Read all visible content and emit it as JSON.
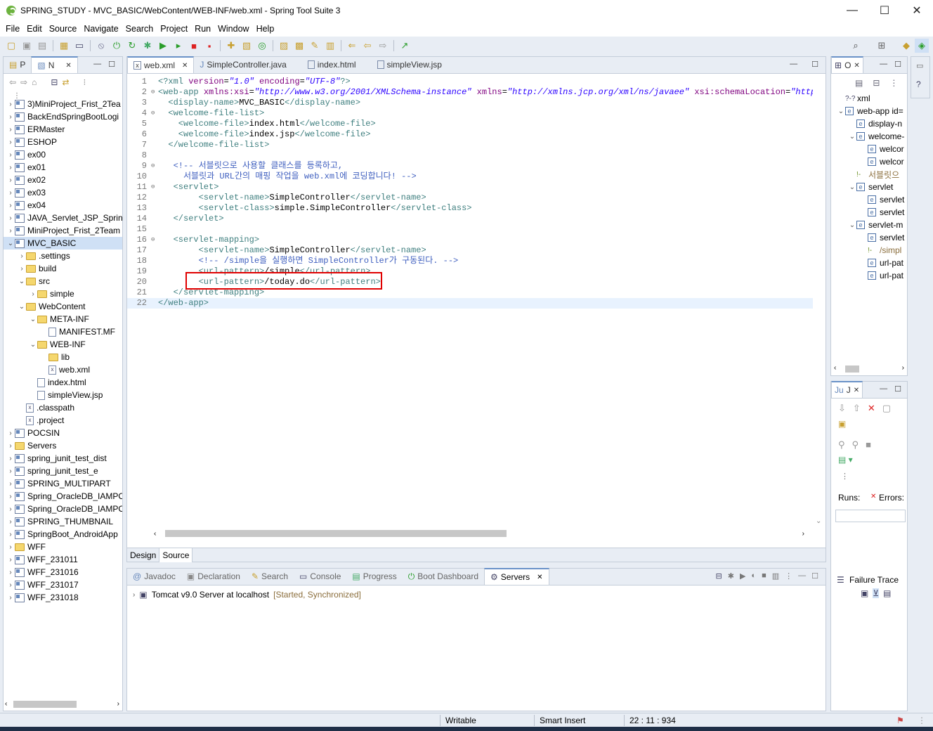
{
  "window": {
    "title": "SPRING_STUDY - MVC_BASIC/WebContent/WEB-INF/web.xml - Spring Tool Suite 3",
    "minimize": "—",
    "maximize": "☐",
    "close": "✕"
  },
  "menu": [
    "File",
    "Edit",
    "Source",
    "Navigate",
    "Search",
    "Project",
    "Run",
    "Window",
    "Help"
  ],
  "explorer": {
    "tabs": [
      "P",
      "N"
    ],
    "items": [
      {
        "label": "3)MiniProject_Frist_2Tea",
        "level": 0,
        "icon": "proj"
      },
      {
        "label": "BackEndSpringBootLogi",
        "level": 0,
        "icon": "proj"
      },
      {
        "label": "ERMaster",
        "level": 0,
        "icon": "proj"
      },
      {
        "label": "ESHOP",
        "level": 0,
        "icon": "proj"
      },
      {
        "label": "ex00",
        "level": 0,
        "icon": "proj"
      },
      {
        "label": "ex01",
        "level": 0,
        "icon": "proj"
      },
      {
        "label": "ex02",
        "level": 0,
        "icon": "proj"
      },
      {
        "label": "ex03",
        "level": 0,
        "icon": "proj"
      },
      {
        "label": "ex04",
        "level": 0,
        "icon": "proj"
      },
      {
        "label": "JAVA_Servlet_JSP_Spring",
        "level": 0,
        "icon": "proj"
      },
      {
        "label": "MiniProject_Frist_2Team",
        "level": 0,
        "icon": "proj"
      },
      {
        "label": "MVC_BASIC",
        "level": 0,
        "icon": "proj",
        "open": true,
        "selected": true
      },
      {
        "label": ".settings",
        "level": 1,
        "icon": "folder"
      },
      {
        "label": "build",
        "level": 1,
        "icon": "folder"
      },
      {
        "label": "src",
        "level": 1,
        "icon": "folder",
        "open": true
      },
      {
        "label": "simple",
        "level": 2,
        "icon": "folder"
      },
      {
        "label": "WebContent",
        "level": 1,
        "icon": "folder",
        "open": true
      },
      {
        "label": "META-INF",
        "level": 2,
        "icon": "folder",
        "open": true
      },
      {
        "label": "MANIFEST.MF",
        "level": 3,
        "icon": "file",
        "leaf": true
      },
      {
        "label": "WEB-INF",
        "level": 2,
        "icon": "folder",
        "open": true
      },
      {
        "label": "lib",
        "level": 3,
        "icon": "folder",
        "leaf": true
      },
      {
        "label": "web.xml",
        "level": 3,
        "icon": "xfile",
        "leaf": true
      },
      {
        "label": "index.html",
        "level": 2,
        "icon": "file",
        "leaf": true
      },
      {
        "label": "simpleView.jsp",
        "level": 2,
        "icon": "file",
        "leaf": true
      },
      {
        "label": ".classpath",
        "level": 1,
        "icon": "xfile",
        "leaf": true
      },
      {
        "label": ".project",
        "level": 1,
        "icon": "xfile",
        "leaf": true
      },
      {
        "label": "POCSIN",
        "level": 0,
        "icon": "proj"
      },
      {
        "label": "Servers",
        "level": 0,
        "icon": "folder"
      },
      {
        "label": "spring_junit_test_dist",
        "level": 0,
        "icon": "proj"
      },
      {
        "label": "spring_junit_test_e",
        "level": 0,
        "icon": "proj"
      },
      {
        "label": "SPRING_MULTIPART",
        "level": 0,
        "icon": "proj"
      },
      {
        "label": "Spring_OracleDB_IAMPO",
        "level": 0,
        "icon": "proj"
      },
      {
        "label": "Spring_OracleDB_IAMPO",
        "level": 0,
        "icon": "proj"
      },
      {
        "label": "SPRING_THUMBNAIL",
        "level": 0,
        "icon": "proj"
      },
      {
        "label": "SpringBoot_AndroidApp",
        "level": 0,
        "icon": "proj"
      },
      {
        "label": "WFF",
        "level": 0,
        "icon": "folder"
      },
      {
        "label": "WFF_231011",
        "level": 0,
        "icon": "proj"
      },
      {
        "label": "WFF_231016",
        "level": 0,
        "icon": "proj"
      },
      {
        "label": "WFF_231017",
        "level": 0,
        "icon": "proj"
      },
      {
        "label": "WFF_231018",
        "level": 0,
        "icon": "proj"
      }
    ]
  },
  "editor": {
    "tabs": [
      {
        "label": "web.xml",
        "active": true
      },
      {
        "label": "SimpleController.java"
      },
      {
        "label": "index.html"
      },
      {
        "label": "simpleView.jsp"
      }
    ],
    "lines": [
      {
        "n": "1",
        "fold": "",
        "segs": [
          [
            "pi",
            "<?xml "
          ],
          [
            "attr",
            "version"
          ],
          [
            "txt",
            "="
          ],
          [
            "val",
            "\"1.0\""
          ],
          [
            "attr",
            " encoding"
          ],
          [
            "txt",
            "="
          ],
          [
            "val",
            "\"UTF-8\""
          ],
          [
            "pi",
            "?>"
          ]
        ]
      },
      {
        "n": "2",
        "fold": "⊖",
        "segs": [
          [
            "tag",
            "<web-app "
          ],
          [
            "attr",
            "xmlns:xsi"
          ],
          [
            "txt",
            "="
          ],
          [
            "val",
            "\"http://www.w3.org/2001/XMLSchema-instance\""
          ],
          [
            "attr",
            " xmlns"
          ],
          [
            "txt",
            "="
          ],
          [
            "val",
            "\"http://xmlns.jcp.org/xml/ns/javaee\""
          ],
          [
            "attr",
            " xsi:schemaLocation"
          ],
          [
            "txt",
            "="
          ],
          [
            "val",
            "\"http:/"
          ]
        ]
      },
      {
        "n": "3",
        "fold": "",
        "segs": [
          [
            "tag",
            "  <display-name>"
          ],
          [
            "txt",
            "MVC_BASIC"
          ],
          [
            "tag",
            "</display-name>"
          ]
        ]
      },
      {
        "n": "4",
        "fold": "⊖",
        "segs": [
          [
            "tag",
            "  <welcome-file-list>"
          ]
        ]
      },
      {
        "n": "5",
        "fold": "",
        "segs": [
          [
            "tag",
            "    <welcome-file>"
          ],
          [
            "txt",
            "index.html"
          ],
          [
            "tag",
            "</welcome-file>"
          ]
        ]
      },
      {
        "n": "6",
        "fold": "",
        "segs": [
          [
            "tag",
            "    <welcome-file>"
          ],
          [
            "txt",
            "index.jsp"
          ],
          [
            "tag",
            "</welcome-file>"
          ]
        ]
      },
      {
        "n": "7",
        "fold": "",
        "segs": [
          [
            "tag",
            "  </welcome-file-list>"
          ]
        ]
      },
      {
        "n": "8",
        "fold": "",
        "segs": []
      },
      {
        "n": "9",
        "fold": "⊖",
        "segs": [
          [
            "cm",
            "   <!-- 서블릿으로 사용할 클래스를 등록하고,"
          ]
        ]
      },
      {
        "n": "10",
        "fold": "",
        "segs": [
          [
            "cm",
            "     서블릿과 URL간의 매핑 작업을 web.xml에 코딩합니다! -->"
          ]
        ]
      },
      {
        "n": "11",
        "fold": "⊖",
        "segs": [
          [
            "tag",
            "   <servlet>"
          ]
        ]
      },
      {
        "n": "12",
        "fold": "",
        "segs": [
          [
            "tag",
            "        <servlet-name>"
          ],
          [
            "txt",
            "SimpleController"
          ],
          [
            "tag",
            "</servlet-name>"
          ]
        ]
      },
      {
        "n": "13",
        "fold": "",
        "segs": [
          [
            "tag",
            "        <servlet-class>"
          ],
          [
            "txt",
            "simple.SimpleController"
          ],
          [
            "tag",
            "</servlet-class>"
          ]
        ]
      },
      {
        "n": "14",
        "fold": "",
        "segs": [
          [
            "tag",
            "   </servlet>"
          ]
        ]
      },
      {
        "n": "15",
        "fold": "",
        "segs": []
      },
      {
        "n": "16",
        "fold": "⊖",
        "segs": [
          [
            "tag",
            "   <servlet-mapping>"
          ]
        ]
      },
      {
        "n": "17",
        "fold": "",
        "segs": [
          [
            "tag",
            "        <servlet-name>"
          ],
          [
            "txt",
            "SimpleController"
          ],
          [
            "tag",
            "</servlet-name>"
          ]
        ]
      },
      {
        "n": "18",
        "fold": "",
        "segs": [
          [
            "cm",
            "        <!-- /simple을 실행하면 SimpleController가 구동된다. -->"
          ]
        ]
      },
      {
        "n": "19",
        "fold": "",
        "segs": [
          [
            "tag",
            "        <url-pattern>"
          ],
          [
            "txt",
            "/simple"
          ],
          [
            "tag",
            "</url-pattern>"
          ]
        ]
      },
      {
        "n": "20",
        "fold": "",
        "segs": [
          [
            "tag",
            "        <url-pattern>"
          ],
          [
            "txt",
            "/today.do"
          ],
          [
            "tag",
            "</url-pattern>"
          ]
        ]
      },
      {
        "n": "21",
        "fold": "",
        "segs": [
          [
            "tag",
            "   </servlet-mapping>"
          ]
        ]
      },
      {
        "n": "22",
        "fold": "",
        "segs": [
          [
            "tag",
            "</web-app>"
          ]
        ],
        "current": true
      }
    ],
    "bottom_tabs": [
      "Design",
      "Source"
    ]
  },
  "servers": {
    "tabs": [
      "Javadoc",
      "Declaration",
      "Search",
      "Console",
      "Progress",
      "Boot Dashboard",
      "Servers"
    ],
    "server_name": "Tomcat v9.0 Server at localhost",
    "server_status": "[Started, Synchronized]"
  },
  "outline": {
    "tab": "O",
    "items": [
      {
        "label": "xml",
        "level": 0,
        "kind": "pi"
      },
      {
        "label": "web-app id=",
        "level": 0,
        "kind": "e",
        "open": true
      },
      {
        "label": "display-n",
        "level": 1,
        "kind": "e"
      },
      {
        "label": "welcome-",
        "level": 1,
        "kind": "e",
        "open": true
      },
      {
        "label": "welcor",
        "level": 2,
        "kind": "e"
      },
      {
        "label": "welcor",
        "level": 2,
        "kind": "e"
      },
      {
        "label": "서블릿으",
        "level": 1,
        "kind": "c"
      },
      {
        "label": "servlet",
        "level": 1,
        "kind": "e",
        "open": true
      },
      {
        "label": "servlet",
        "level": 2,
        "kind": "e"
      },
      {
        "label": "servlet",
        "level": 2,
        "kind": "e"
      },
      {
        "label": "servlet-m",
        "level": 1,
        "kind": "e",
        "open": true
      },
      {
        "label": "servlet",
        "level": 2,
        "kind": "e"
      },
      {
        "label": "/simpl",
        "level": 2,
        "kind": "c"
      },
      {
        "label": "url-pat",
        "level": 2,
        "kind": "e"
      },
      {
        "label": "url-pat",
        "level": 2,
        "kind": "e"
      }
    ]
  },
  "junit": {
    "tab": "J",
    "runs_label": "Runs:",
    "errors_label": "Errors:",
    "failure_trace": "Failure Trace"
  },
  "status": {
    "writable": "Writable",
    "insert_mode": "Smart Insert",
    "position": "22 : 11 : 934"
  }
}
